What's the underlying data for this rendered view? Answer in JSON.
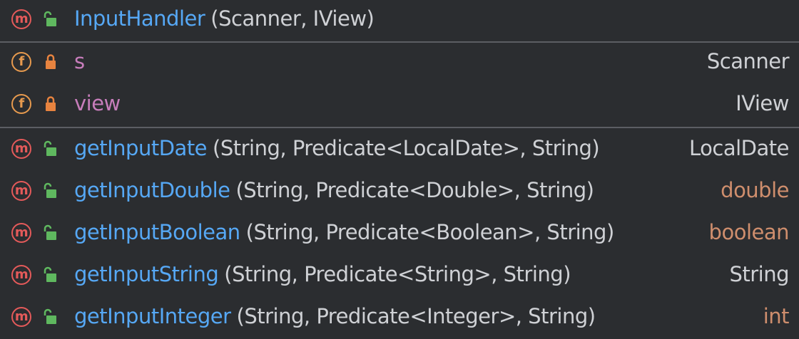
{
  "constructor": {
    "kind_glyph": "m",
    "name": "InputHandler",
    "params": "(Scanner, IView)"
  },
  "fields": [
    {
      "kind_glyph": "f",
      "name": "s",
      "type": "Scanner"
    },
    {
      "kind_glyph": "f",
      "name": "view",
      "type": "IView"
    }
  ],
  "methods": [
    {
      "kind_glyph": "m",
      "name": "getInputDate",
      "params": "(String, Predicate<LocalDate>, String)",
      "type": "LocalDate"
    },
    {
      "kind_glyph": "m",
      "name": "getInputDouble",
      "params": "(String, Predicate<Double>, String)",
      "type": "double"
    },
    {
      "kind_glyph": "m",
      "name": "getInputBoolean",
      "params": "(String, Predicate<Boolean>, String)",
      "type": "boolean"
    },
    {
      "kind_glyph": "m",
      "name": "getInputString",
      "params": "(String, Predicate<String>, String)",
      "type": "String"
    },
    {
      "kind_glyph": "m",
      "name": "getInputInteger",
      "params": "(String, Predicate<Integer>, String)",
      "type": "int"
    }
  ],
  "icons": {
    "method": "method-icon",
    "field": "field-icon",
    "public": "unlocked-icon",
    "private": "locked-icon"
  },
  "colors": {
    "background": "#2b2d30",
    "method_name": "#56a8f5",
    "field_name": "#c77dbb",
    "primitive_type": "#cf8e6d",
    "text": "#cfd1d5",
    "method_icon": "#e45a5a",
    "field_icon": "#e79a4e",
    "public_lock": "#5fb85f",
    "private_lock": "#e7833f"
  }
}
